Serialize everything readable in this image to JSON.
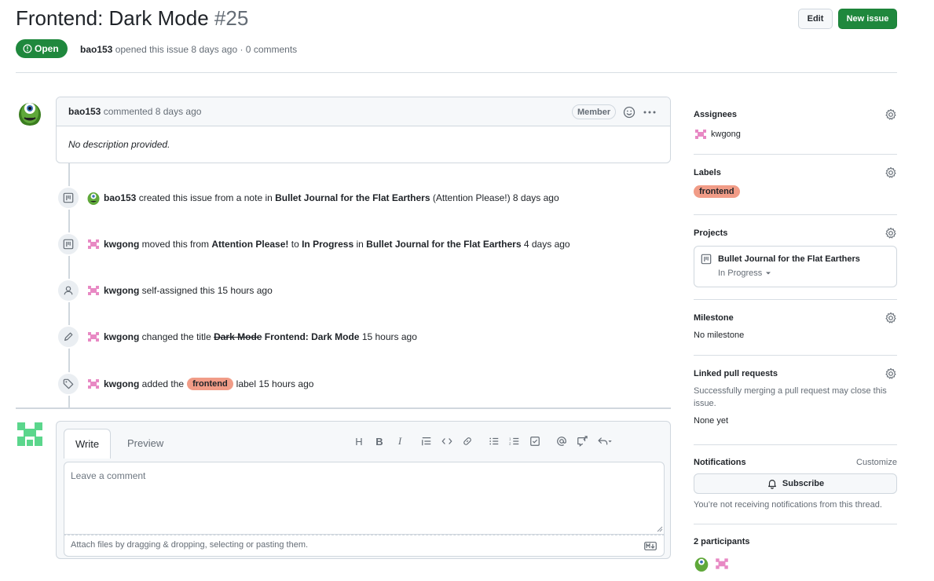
{
  "issue": {
    "title": "Frontend: Dark Mode",
    "number": "#25",
    "state": "Open",
    "author": "bao153",
    "opened_text": "opened this issue 8 days ago · 0 comments"
  },
  "header": {
    "edit_label": "Edit",
    "new_issue_label": "New issue"
  },
  "comment": {
    "author": "bao153",
    "time": "commented 8 days ago",
    "role": "Member",
    "body": "No description provided."
  },
  "events": [
    {
      "user": "bao153",
      "t1": "created this issue from a note in",
      "project": "Bullet Journal for the Flat Earthers",
      "t2": "(Attention Please!) 8 days ago"
    },
    {
      "user": "kwgong",
      "t1": "moved this from",
      "from": "Attention Please!",
      "t2": "to",
      "to": "In Progress",
      "t3": "in",
      "project": "Bullet Journal for the Flat Earthers",
      "t4": "4 days ago"
    },
    {
      "user": "kwgong",
      "t1": "self-assigned this 15 hours ago"
    },
    {
      "user": "kwgong",
      "t1": "changed the title",
      "old": "Dark Mode",
      "new": "Frontend: Dark Mode",
      "t2": "15 hours ago"
    },
    {
      "user": "kwgong",
      "t1": "added the",
      "label": "frontend",
      "t2": "label 15 hours ago"
    }
  ],
  "editor": {
    "tab_write": "Write",
    "tab_preview": "Preview",
    "placeholder": "Leave a comment",
    "attach_text": "Attach files by dragging & dropping, selecting or pasting them."
  },
  "sidebar": {
    "assignees": {
      "heading": "Assignees",
      "value": "kwgong"
    },
    "labels": {
      "heading": "Labels",
      "value": "frontend"
    },
    "projects": {
      "heading": "Projects",
      "name": "Bullet Journal for the Flat Earthers",
      "status": "In Progress"
    },
    "milestone": {
      "heading": "Milestone",
      "value": "No milestone"
    },
    "linked_prs": {
      "heading": "Linked pull requests",
      "desc": "Successfully merging a pull request may close this issue.",
      "value": "None yet"
    },
    "notifications": {
      "heading": "Notifications",
      "customize": "Customize",
      "subscribe": "Subscribe",
      "desc": "You’re not receiving notifications from this thread."
    },
    "participants": {
      "heading": "2 participants"
    }
  },
  "colors": {
    "open_green": "#1f883d",
    "label_frontend": "#f19c87"
  }
}
